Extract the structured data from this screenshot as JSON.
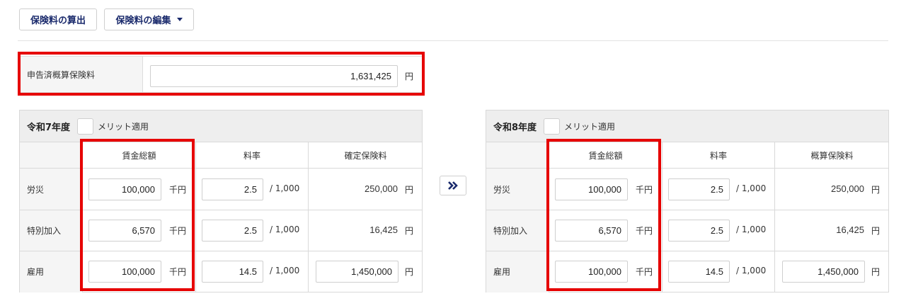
{
  "toolbar": {
    "calc_label": "保険料の算出",
    "edit_label": "保険料の編集"
  },
  "declared": {
    "label": "申告済概算保険料",
    "value": "1,631,425",
    "unit": "円"
  },
  "left_table": {
    "year": "令和7年度",
    "merit_label": "メリット適用",
    "columns": [
      "賃金総額",
      "料率",
      "確定保険料"
    ],
    "rows": [
      {
        "label": "労災",
        "wage": "100,000",
        "wage_unit": "千円",
        "rate": "2.5",
        "rate_unit": "/ 1,000",
        "premium": "250,000",
        "premium_unit": "円"
      },
      {
        "label": "特別加入",
        "wage": "6,570",
        "wage_unit": "千円",
        "rate": "2.5",
        "rate_unit": "/ 1,000",
        "premium": "16,425",
        "premium_unit": "円"
      },
      {
        "label": "雇用",
        "wage": "100,000",
        "wage_unit": "千円",
        "rate": "14.5",
        "rate_unit": "/ 1,000",
        "premium": "1,450,000",
        "premium_unit": "円"
      }
    ]
  },
  "right_table": {
    "year": "令和8年度",
    "merit_label": "メリット適用",
    "columns": [
      "賃金総額",
      "料率",
      "概算保険料"
    ],
    "rows": [
      {
        "label": "労災",
        "wage": "100,000",
        "wage_unit": "千円",
        "rate": "2.5",
        "rate_unit": "/ 1,000",
        "premium": "250,000",
        "premium_unit": "円"
      },
      {
        "label": "特別加入",
        "wage": "6,570",
        "wage_unit": "千円",
        "rate": "2.5",
        "rate_unit": "/ 1,000",
        "premium": "16,425",
        "premium_unit": "円"
      },
      {
        "label": "雇用",
        "wage": "100,000",
        "wage_unit": "千円",
        "rate": "14.5",
        "rate_unit": "/ 1,000",
        "premium": "1,450,000",
        "premium_unit": "円"
      }
    ]
  },
  "icons": {
    "copy_arrow": "double-chevron-right-icon",
    "dropdown": "caret-down-icon"
  },
  "colors": {
    "accent": "#1a2a6c",
    "highlight": "#e60000"
  }
}
